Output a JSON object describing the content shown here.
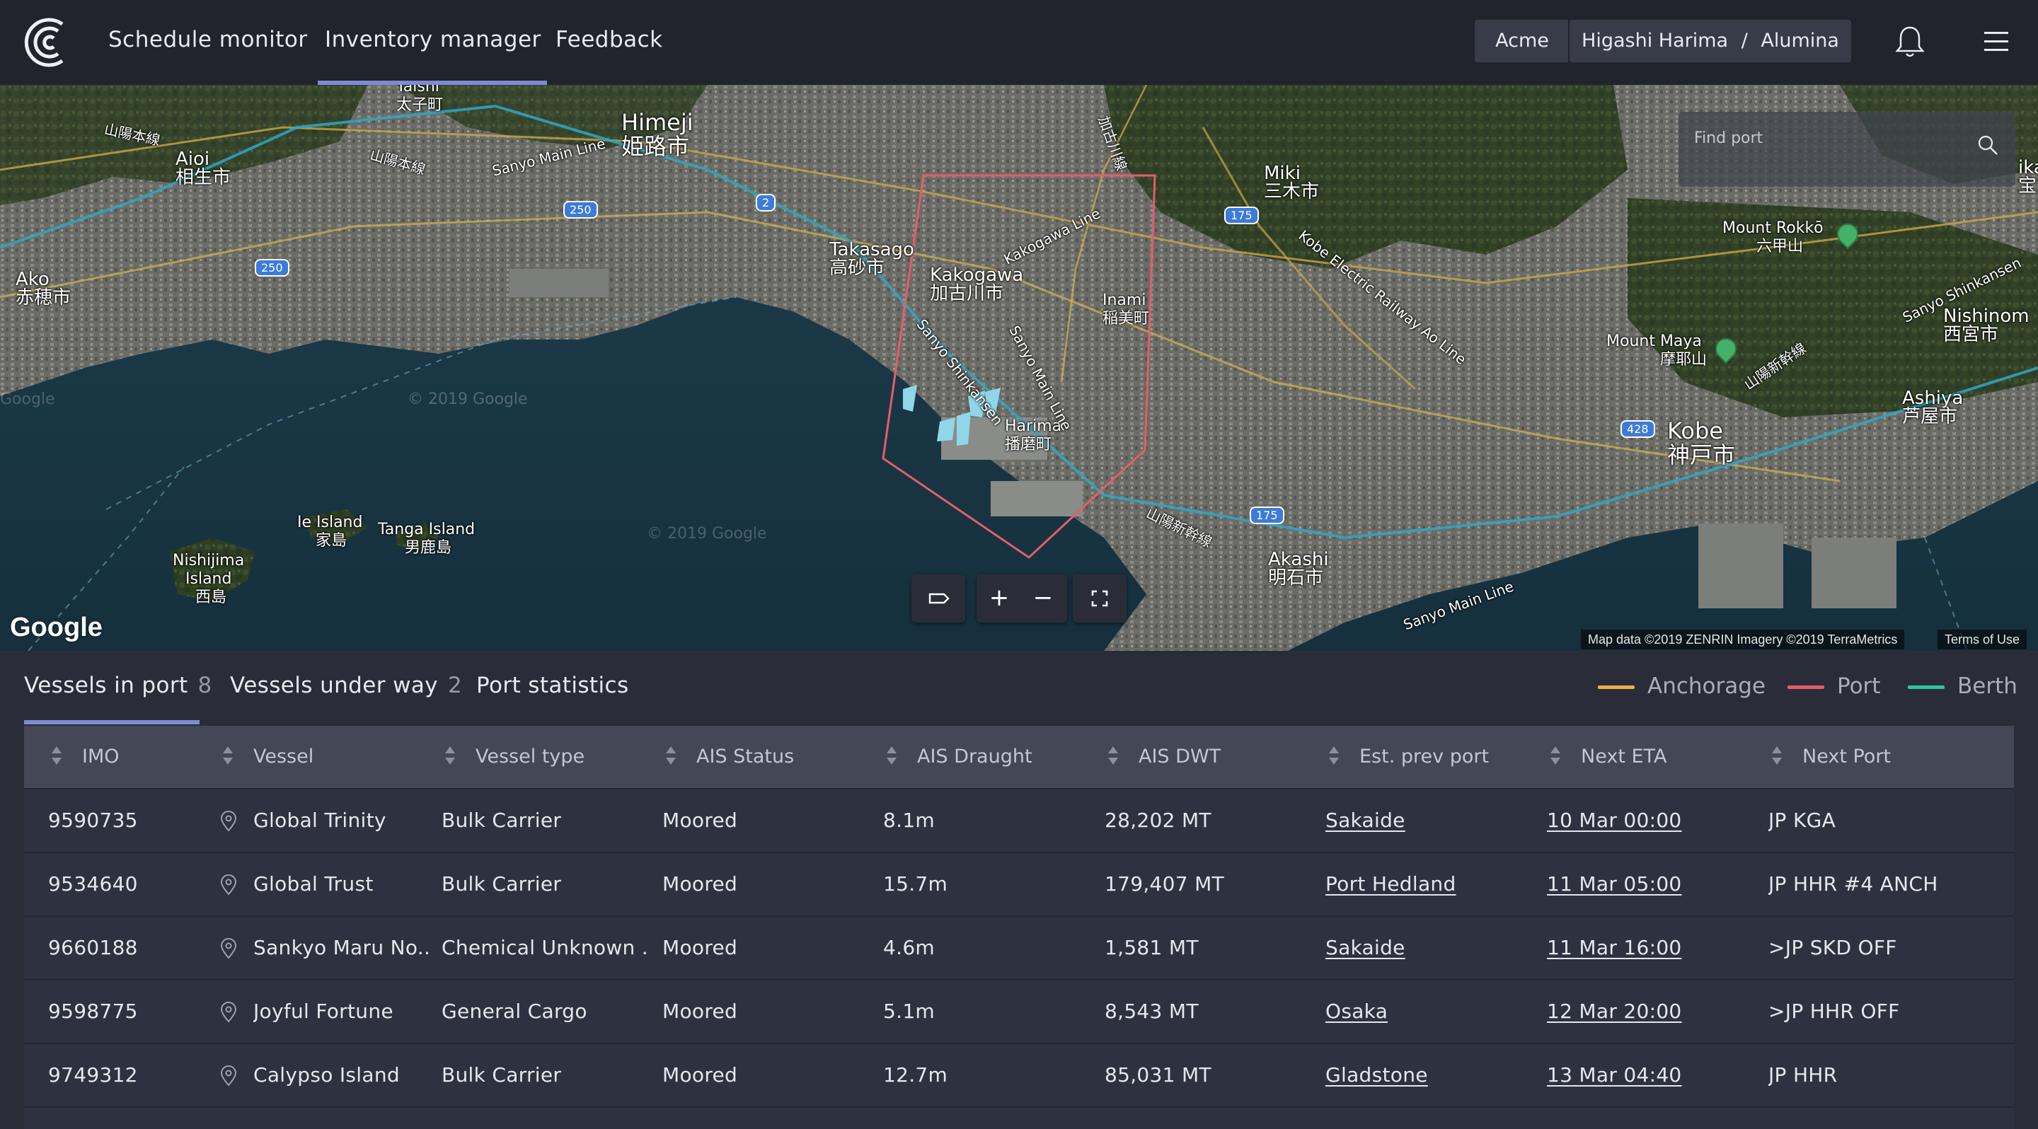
{
  "nav": {
    "items": [
      {
        "label": "Schedule monitor"
      },
      {
        "label": "Inventory manager"
      },
      {
        "label": "Feedback"
      }
    ],
    "active_index": 1,
    "context": {
      "org": "Acme",
      "port": "Higashi Harima",
      "separator": "/",
      "commodity": "Alumina"
    }
  },
  "map": {
    "search_placeholder": "Find port",
    "labels": {
      "himeji": "Himeji",
      "himeji_jp": "姫路市",
      "aioi": "Aioi",
      "aioi_jp": "相生市",
      "ako": "Ako",
      "ako_jp": "赤穂市",
      "taishi": "Taishi",
      "taishi_jp": "太子町",
      "takasago": "Takasago",
      "takasago_jp": "高砂市",
      "kakogawa": "Kakogawa",
      "kakogawa_jp": "加古川市",
      "inami": "Inami",
      "inami_jp": "稲美町",
      "harima": "Harima",
      "harima_jp": "播磨町",
      "miki": "Miki",
      "miki_jp": "三木市",
      "akashi": "Akashi",
      "akashi_jp": "明石市",
      "kobe": "Kobe",
      "kobe_jp": "神戸市",
      "ashiya": "Ashiya",
      "ashiya_jp": "芦屋市",
      "nishinomiya": "Nishinom",
      "nishinomiya_jp": "西宮市",
      "mount_rokko": "Mount Rokkō",
      "mount_rokko_jp": "六甲山",
      "mount_maya": "Mount Maya",
      "mount_maya_jp": "摩耶山",
      "ie_island": "Ie Island",
      "ie_island_jp": "家島",
      "tanga_island": "Tanga Island",
      "tanga_island_jp": "男鹿島",
      "nishijima": "Nishijima",
      "nishijima_island": "Island",
      "nishijima_jp": "西島",
      "sanyo_main_line": "Sanyo Main Line",
      "sanyo_main_line_2": "Sanyo Main Line",
      "sanyo_main_line_3": "Sanyo Main Line",
      "kakogawa_line": "Kakogawa Line",
      "sanyo_shinkansen": "Sanyo Shinkansen",
      "sanyo_shinkansen_2": "Sanyo Shinkansen",
      "kobe_electric": "Kobe Electric Railway Ao Line",
      "sanyo_honsen": "山陽本線",
      "sanyo_honsen_2": "山陽本線",
      "sanyo_shinkansen_jp": "山陽新幹線",
      "sanyo_shinkansen_jp_2": "山陽新幹線",
      "shinkansen_branch": "加古川線",
      "aka": "ika",
      "ka_jp": "宝",
      "watermark_1": "© 2019 Google",
      "watermark_2": "© 2019 Google",
      "watermark_3": "Google"
    },
    "road_shields": [
      "250",
      "250",
      "2",
      "175",
      "175",
      "428"
    ],
    "google_logo": "Google",
    "attribution": "Map data ©2019 ZENRIN Imagery ©2019 TerraMetrics",
    "terms": "Terms of Use",
    "controls": {
      "zoom_in": "+",
      "zoom_out": "−"
    }
  },
  "tabs": [
    {
      "label": "Vessels in port",
      "count": "8"
    },
    {
      "label": "Vessels under way",
      "count": "2"
    },
    {
      "label": "Port statistics",
      "count": ""
    }
  ],
  "legend": [
    {
      "label": "Anchorage",
      "color": "#e7b04b"
    },
    {
      "label": "Port",
      "color": "#e45d6b"
    },
    {
      "label": "Berth",
      "color": "#2ec4a0"
    }
  ],
  "colors": {
    "accent": "#7d8bd6",
    "port_boundary": "#e45d6b",
    "vessel": "#8fd6e8"
  },
  "table": {
    "columns": [
      "IMO",
      "Vessel",
      "Vessel type",
      "AIS Status",
      "AIS Draught",
      "AIS DWT",
      "Est. prev port",
      "Next ETA",
      "Next Port"
    ],
    "rows": [
      {
        "imo": "9590735",
        "vessel": "Global Trinity",
        "type": "Bulk Carrier",
        "status": "Moored",
        "draught": "8.1m",
        "dwt": "28,202 MT",
        "prev_port": "Sakaide",
        "eta": "10 Mar 00:00",
        "next_port": "JP KGA"
      },
      {
        "imo": "9534640",
        "vessel": "Global Trust",
        "type": "Bulk Carrier",
        "status": "Moored",
        "draught": "15.7m",
        "dwt": "179,407 MT",
        "prev_port": "Port Hedland",
        "eta": "11 Mar 05:00",
        "next_port": "JP HHR #4 ANCH"
      },
      {
        "imo": "9660188",
        "vessel": "Sankyo Maru No...",
        "type": "Chemical Unknown ...",
        "status": "Moored",
        "draught": "4.6m",
        "dwt": "1,581 MT",
        "prev_port": "Sakaide",
        "eta": "11 Mar 16:00",
        "next_port": ">JP SKD OFF"
      },
      {
        "imo": "9598775",
        "vessel": "Joyful Fortune",
        "type": "General Cargo",
        "status": "Moored",
        "draught": "5.1m",
        "dwt": "8,543 MT",
        "prev_port": "Osaka",
        "eta": "12 Mar 20:00",
        "next_port": ">JP HHR OFF"
      },
      {
        "imo": "9749312",
        "vessel": "Calypso Island",
        "type": "Bulk Carrier",
        "status": "Moored",
        "draught": "12.7m",
        "dwt": "85,031 MT",
        "prev_port": "Gladstone",
        "eta": "13 Mar 04:40",
        "next_port": "JP HHR"
      }
    ]
  }
}
